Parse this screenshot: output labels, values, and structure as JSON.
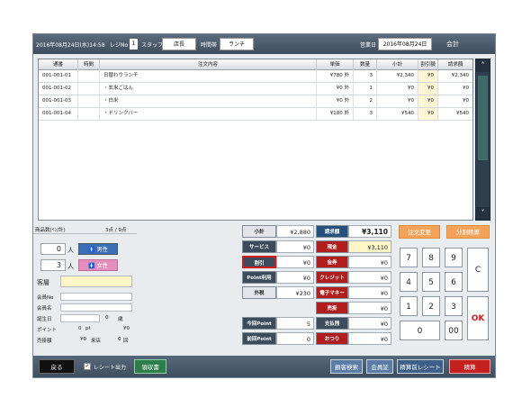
{
  "header": {
    "datetime": "2016年08月24日(水)14:58",
    "register_label": "レジNo",
    "register_no": "1",
    "staff_label": "スタッフ",
    "staff_value": "店長",
    "timeslot_label": "時間帯",
    "timeslot_value": "ランチ",
    "business_date_label": "営業日",
    "business_date_value": "2016年08月24日",
    "screen_title": "会計"
  },
  "table": {
    "columns": [
      "通番",
      "時間",
      "注文内容",
      "単価",
      "数量",
      "小計",
      "割引額",
      "請求額"
    ],
    "rows": [
      {
        "no": "001-001-01",
        "time": "",
        "item": "日替わりランチ",
        "price": "¥780 外",
        "qty": "3",
        "subtotal": "¥2,340",
        "discount": "¥0",
        "billed": "¥2,340"
      },
      {
        "no": "001-001-02",
        "time": "",
        "item": "・玄米ごはん",
        "price": "¥0 外",
        "qty": "1",
        "subtotal": "¥0",
        "discount": "¥0",
        "billed": "¥0"
      },
      {
        "no": "001-001-03",
        "time": "",
        "item": "・白米",
        "price": "¥0 外",
        "qty": "2",
        "subtotal": "¥0",
        "discount": "¥0",
        "billed": "¥0"
      },
      {
        "no": "001-001-04",
        "time": "",
        "item": "・ドリンクバー",
        "price": "¥180 外",
        "qty": "3",
        "subtotal": "¥540",
        "discount": "¥0",
        "billed": "¥540"
      }
    ]
  },
  "left": {
    "items_label": "商品数(ｲﾝ/計)",
    "items_value": "3点 / 9点",
    "male_count": "0",
    "female_count": "3",
    "person_unit": "人",
    "male_label": "男性",
    "female_label": "女性",
    "customer_type_label": "客層",
    "member_no_label": "会員No",
    "member_name_label": "会員名",
    "birthday_label": "誕生日",
    "birthday_value": "0",
    "birthday_unit": "歳",
    "point_label": "ポイント",
    "point_value": "0",
    "point_unit": "pt",
    "point_yen": "¥0",
    "sales_label": "売掛額",
    "sales_value": "¥0",
    "visits_label": "来店",
    "visits_value": "0",
    "visits_unit": "回"
  },
  "totals": {
    "subtotal_label": "小計",
    "subtotal_value": "¥2,880",
    "service_label": "サービス",
    "service_value": "¥0",
    "discount_label": "割引",
    "discount_value": "¥0",
    "point_use_label": "Point利用",
    "point_use_value": "¥0",
    "tax_label": "外税",
    "tax_value": "¥230",
    "this_point_label": "今回Point",
    "this_point_value": "5",
    "prev_point_label": "前回Point",
    "prev_point_value": "0",
    "billed_label": "請求額",
    "billed_value": "¥3,110",
    "cash_label": "現金",
    "cash_value": "¥3,110",
    "voucher_label": "金券",
    "voucher_value": "¥0",
    "credit_label": "クレジット",
    "credit_value": "¥0",
    "emoney_label": "電子マネー",
    "emoney_value": "¥0",
    "receivable_label": "売掛",
    "receivable_value": "¥0",
    "paid_total_label": "支払残",
    "paid_total_value": "¥0",
    "change_label": "おつり",
    "change_value": "¥0"
  },
  "actions": {
    "order_change": "注文変更",
    "split_pay": "分割精算"
  },
  "keypad": {
    "k7": "7",
    "k8": "8",
    "k9": "9",
    "k4": "4",
    "k5": "5",
    "k6": "6",
    "k1": "1",
    "k2": "2",
    "k3": "3",
    "k0": "0",
    "k00": "00",
    "clear": "C",
    "ok": "OK"
  },
  "footer": {
    "back": "戻る",
    "receipt_label": "レシート出力",
    "receipt_slip": "領収書",
    "customer_search": "顧客検索",
    "member_card": "会員証",
    "pre_receipt": "精算前レシート",
    "settle": "精算"
  },
  "colors": {
    "header_bg": "#3f4e5d",
    "highlight_yellow": "#fff6d6",
    "accent_orange": "#f3a35a",
    "settle_red": "#c42020",
    "male_blue": "#3b6fb4",
    "female_pink": "#e58fbf"
  }
}
